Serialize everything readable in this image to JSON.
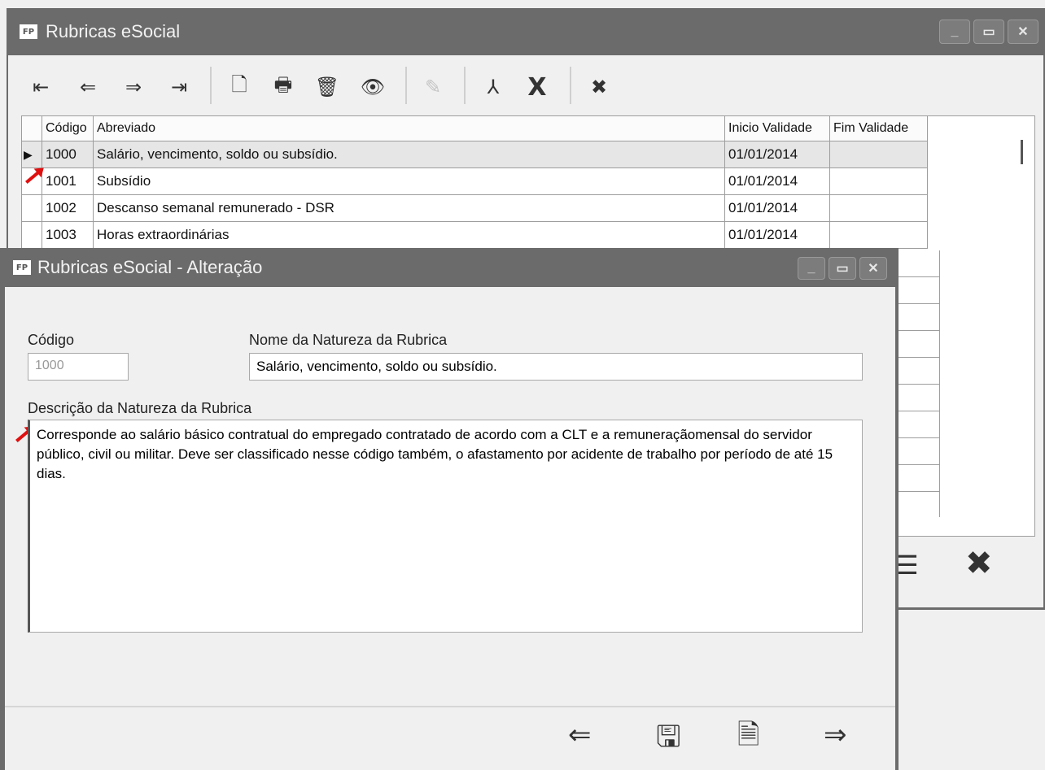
{
  "main_window": {
    "title": "Rubricas eSocial",
    "app_badge": "FP",
    "toolbar": [
      {
        "name": "first-record-button",
        "glyph": "⇤"
      },
      {
        "name": "previous-record-button",
        "glyph": "⇐"
      },
      {
        "name": "next-record-button",
        "glyph": "⇒"
      },
      {
        "name": "last-record-button",
        "glyph": "⇥"
      },
      {
        "name": "new-document-button",
        "glyph": "🗋"
      },
      {
        "name": "print-button",
        "glyph": "🖶"
      },
      {
        "name": "delete-button",
        "glyph": "🗑"
      },
      {
        "name": "view-button",
        "glyph": "👁"
      },
      {
        "name": "edit-button",
        "glyph": "✎"
      },
      {
        "name": "pdf-button",
        "glyph": "⅄"
      },
      {
        "name": "excel-button",
        "glyph": "X"
      },
      {
        "name": "close-button",
        "glyph": "✖"
      }
    ],
    "grid": {
      "columns": [
        "Código",
        "Abreviado",
        "Inicio Validade",
        "Fim Validade"
      ],
      "rows": [
        {
          "codigo": "1000",
          "abreviado": "Salário, vencimento, soldo ou subsídio.",
          "inicio": "01/01/2014",
          "fim": ""
        },
        {
          "codigo": "1001",
          "abreviado": "Subsídio",
          "inicio": "01/01/2014",
          "fim": ""
        },
        {
          "codigo": "1002",
          "abreviado": "Descanso semanal remunerado - DSR",
          "inicio": "01/01/2014",
          "fim": ""
        },
        {
          "codigo": "1003",
          "abreviado": "Horas extraordinárias",
          "inicio": "01/01/2014",
          "fim": ""
        }
      ]
    }
  },
  "dialog": {
    "title": "Rubricas eSocial - Alteração",
    "app_badge": "FP",
    "codigo_label": "Código",
    "codigo_value": "1000",
    "nome_label": "Nome da Natureza da Rubrica",
    "nome_value": "Salário, vencimento, soldo ou subsídio.",
    "descricao_label": "Descrição da Natureza da Rubrica",
    "descricao_value": "Corresponde ao salário básico contratual do empregado contratado de acordo com a CLT e a remuneraçãomensal do servidor público, civil ou militar. Deve ser classificado nesse código também, o afastamento por acidente de trabalho por período de até 15 dias."
  },
  "colors": {
    "titlebar": "#6b6b6b",
    "annotation": "#e01010"
  }
}
